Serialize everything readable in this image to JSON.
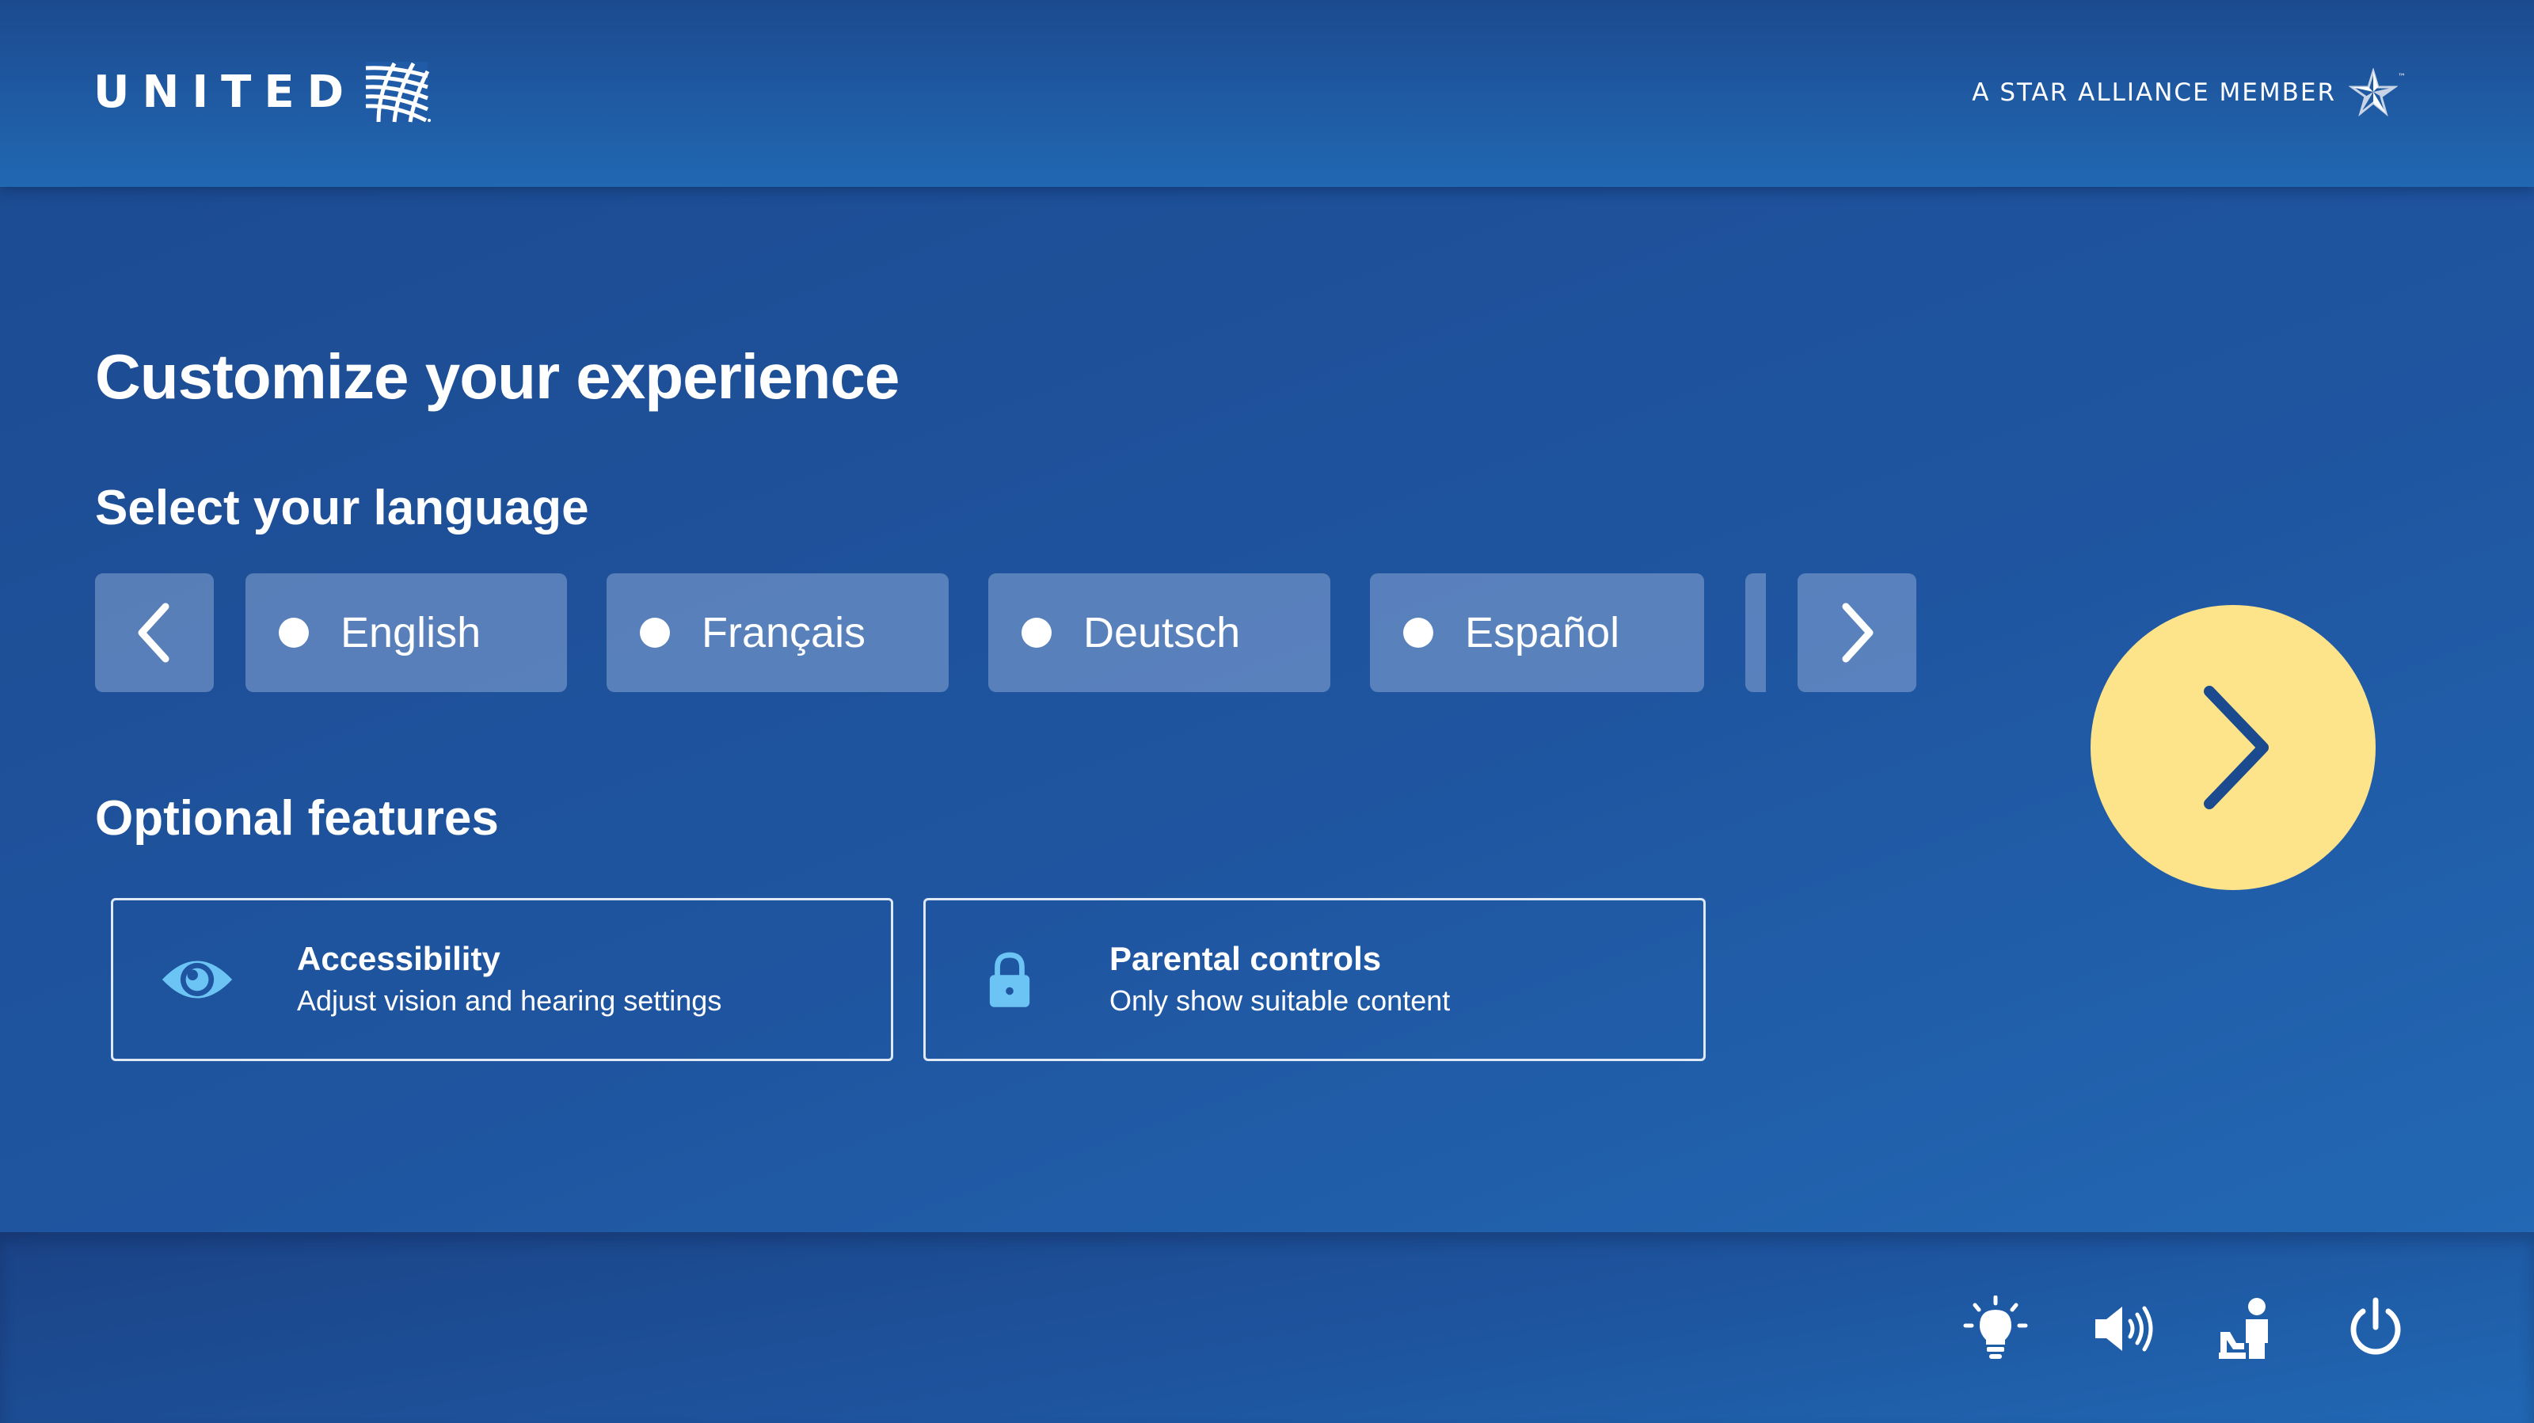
{
  "header": {
    "brand": "UNITED",
    "alliance_text": "A STAR ALLIANCE MEMBER",
    "trademark": "™"
  },
  "main": {
    "title": "Customize your experience",
    "language_label": "Select your language",
    "languages": [
      {
        "label": "English",
        "selected": false
      },
      {
        "label": "Français",
        "selected": false
      },
      {
        "label": "Deutsch",
        "selected": false
      },
      {
        "label": "Español",
        "selected": false
      }
    ],
    "optional_label": "Optional features",
    "features": [
      {
        "name": "Accessibility",
        "description": "Adjust vision and hearing settings",
        "icon": "eye-icon"
      },
      {
        "name": "Parental controls",
        "description": "Only show suitable content",
        "icon": "lock-icon"
      }
    ]
  },
  "footer": {
    "controls": [
      "light-bulb-icon",
      "volume-icon",
      "call-attendant-icon",
      "power-icon"
    ]
  },
  "colors": {
    "background": "#1f55a0",
    "tile": "#7f9fce",
    "accent_yellow": "#fde48b",
    "icon_blue": "#6cc4f5",
    "arrow_dark": "#1c4a8f"
  }
}
